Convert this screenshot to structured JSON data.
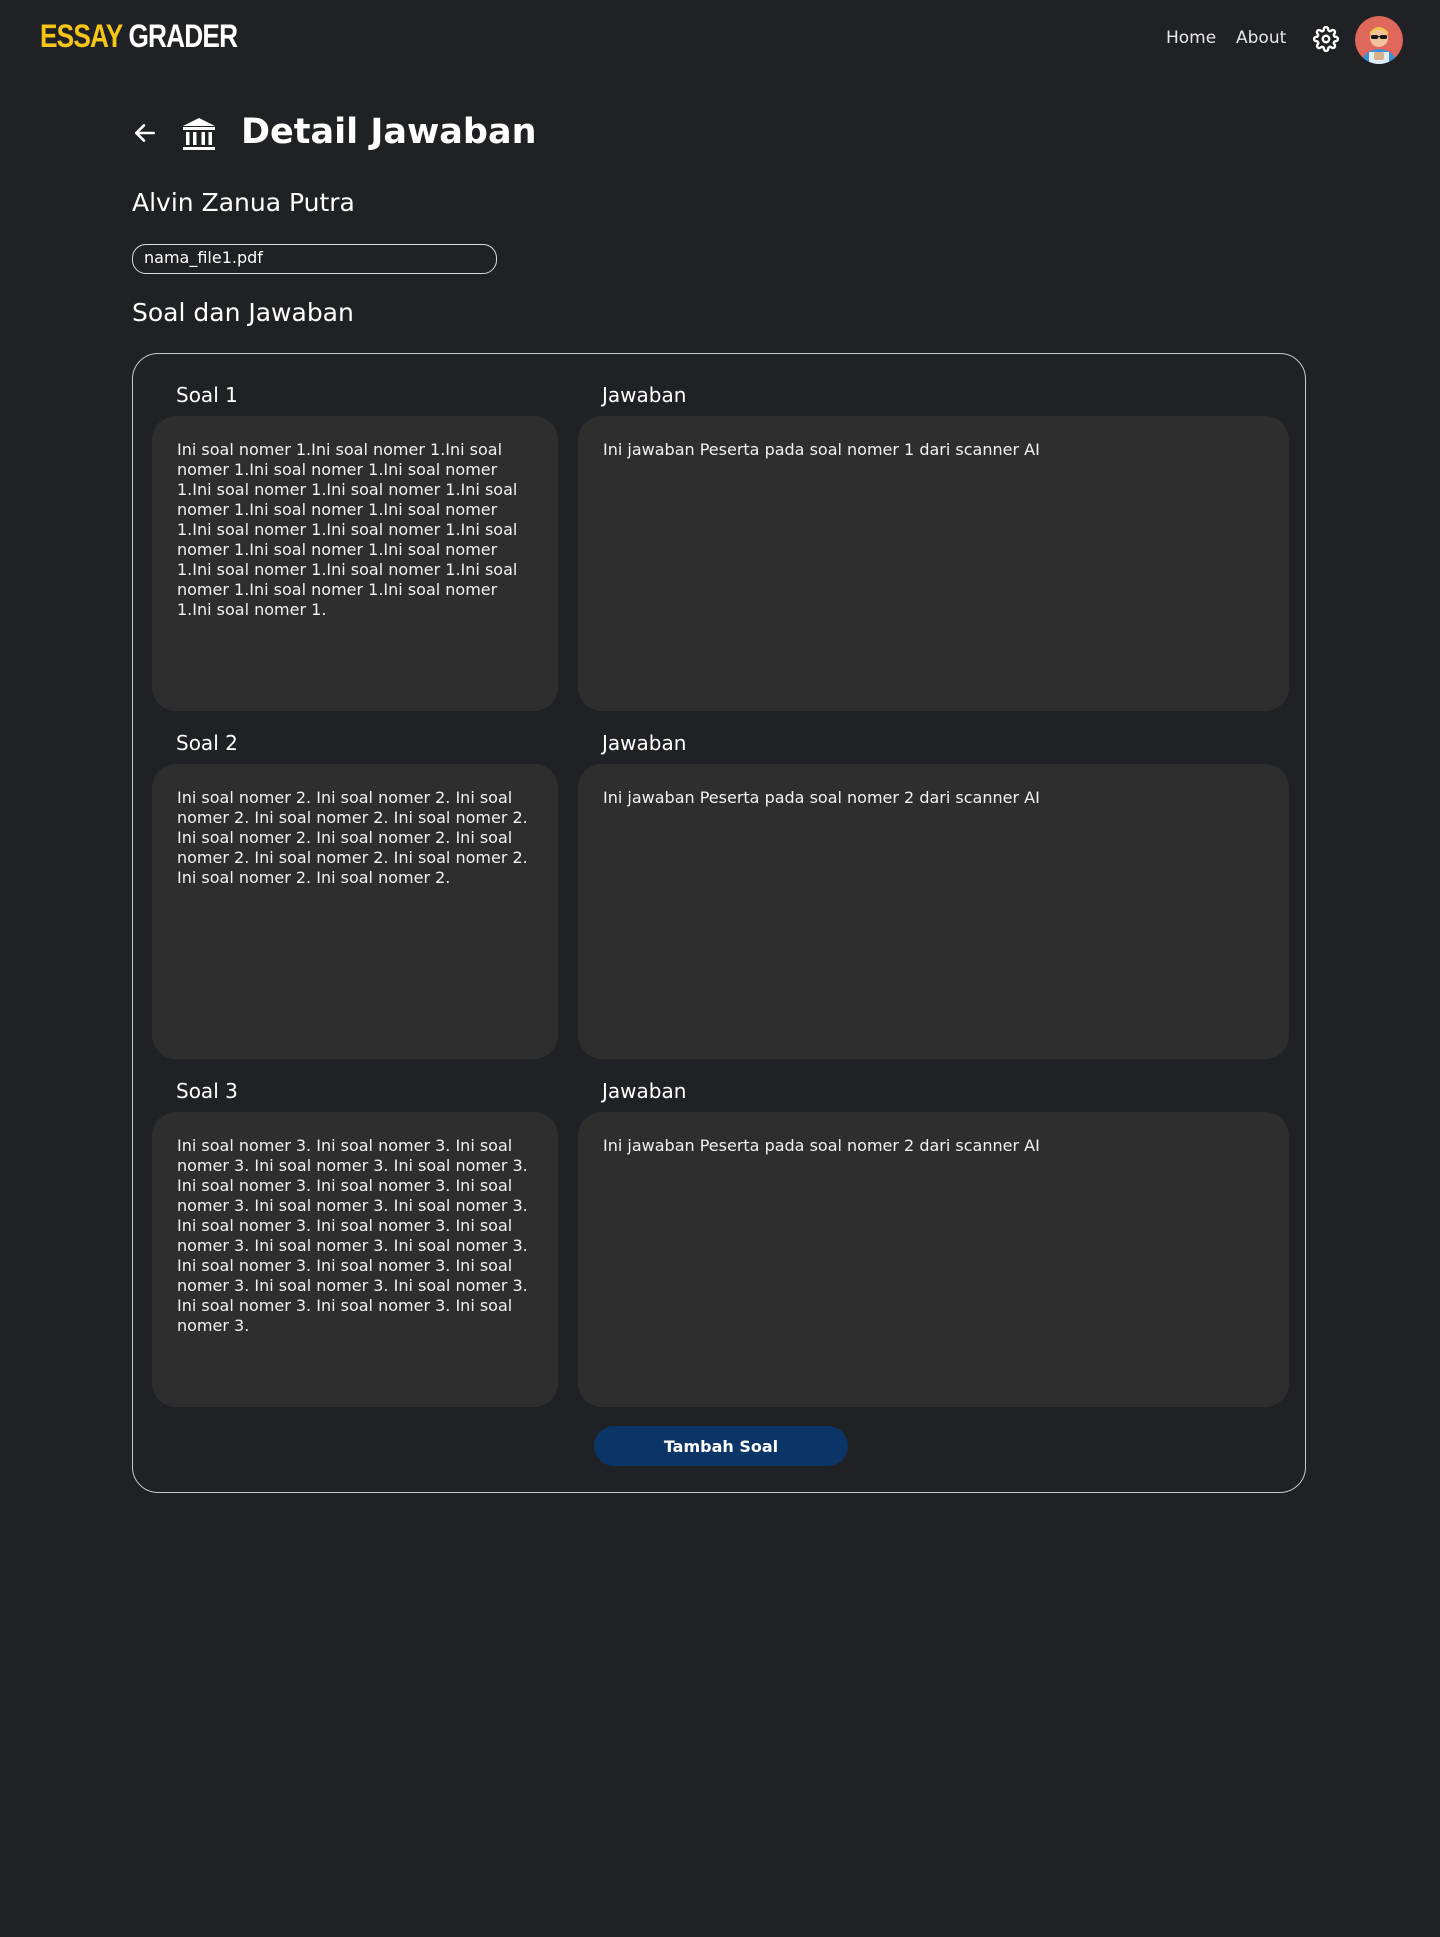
{
  "header": {
    "logo_part1": "ESSAY",
    "logo_part2": "GRADER",
    "nav": {
      "home": "Home",
      "about": "About"
    },
    "colors": {
      "logo_accent": "#f5c518",
      "background": "#202124"
    }
  },
  "page": {
    "title": "Detail Jawaban",
    "student_name": "Alvin Zanua Putra",
    "file_name": "nama_file1.pdf",
    "section_title": "Soal dan Jawaban"
  },
  "questions": [
    {
      "label": "Soal 1",
      "text": " Ini soal nomer 1.Ini soal nomer 1.Ini soal nomer 1.Ini soal nomer 1.Ini soal nomer 1.Ini soal nomer 1.Ini soal nomer 1.Ini soal nomer 1.Ini soal nomer 1.Ini soal nomer 1.Ini soal nomer 1.Ini soal nomer 1.Ini soal nomer 1.Ini soal nomer 1.Ini soal nomer 1.Ini soal nomer 1.Ini soal nomer 1.Ini soal nomer 1.Ini soal nomer 1.Ini soal nomer 1.Ini soal nomer 1.",
      "answer_label": "Jawaban",
      "answer": "Ini jawaban Peserta pada soal nomer 1 dari scanner AI"
    },
    {
      "label": "Soal 2",
      "text": "Ini soal nomer 2. Ini soal nomer 2. Ini soal nomer 2. Ini soal nomer 2. Ini soal nomer 2. Ini soal nomer 2. Ini soal nomer 2. Ini soal nomer 2. Ini soal nomer 2. Ini soal nomer 2. Ini soal nomer 2. Ini soal nomer 2.",
      "answer_label": "Jawaban",
      "answer": "Ini jawaban Peserta pada soal nomer 2 dari scanner AI"
    },
    {
      "label": "Soal 3",
      "text": "Ini soal nomer 3. Ini soal nomer 3. Ini soal nomer 3. Ini soal nomer 3. Ini soal nomer 3. Ini soal nomer 3. Ini soal nomer 3. Ini soal nomer 3. Ini soal nomer 3. Ini soal nomer 3. Ini soal nomer 3. Ini soal nomer 3. Ini soal nomer 3. Ini soal nomer 3. Ini soal nomer 3. Ini soal nomer 3. Ini soal nomer 3. Ini soal nomer 3. Ini soal nomer 3. Ini soal nomer 3. Ini soal nomer 3. Ini soal nomer 3. Ini soal nomer 3.",
      "answer_label": "Jawaban",
      "answer": "Ini jawaban Peserta pada soal nomer 2 dari scanner AI"
    }
  ],
  "actions": {
    "add_question": "Tambah Soal",
    "button_color": "#0b3566"
  },
  "icons": {
    "back": "arrow-left-icon",
    "institution": "bank-icon",
    "settings": "gear-icon"
  }
}
